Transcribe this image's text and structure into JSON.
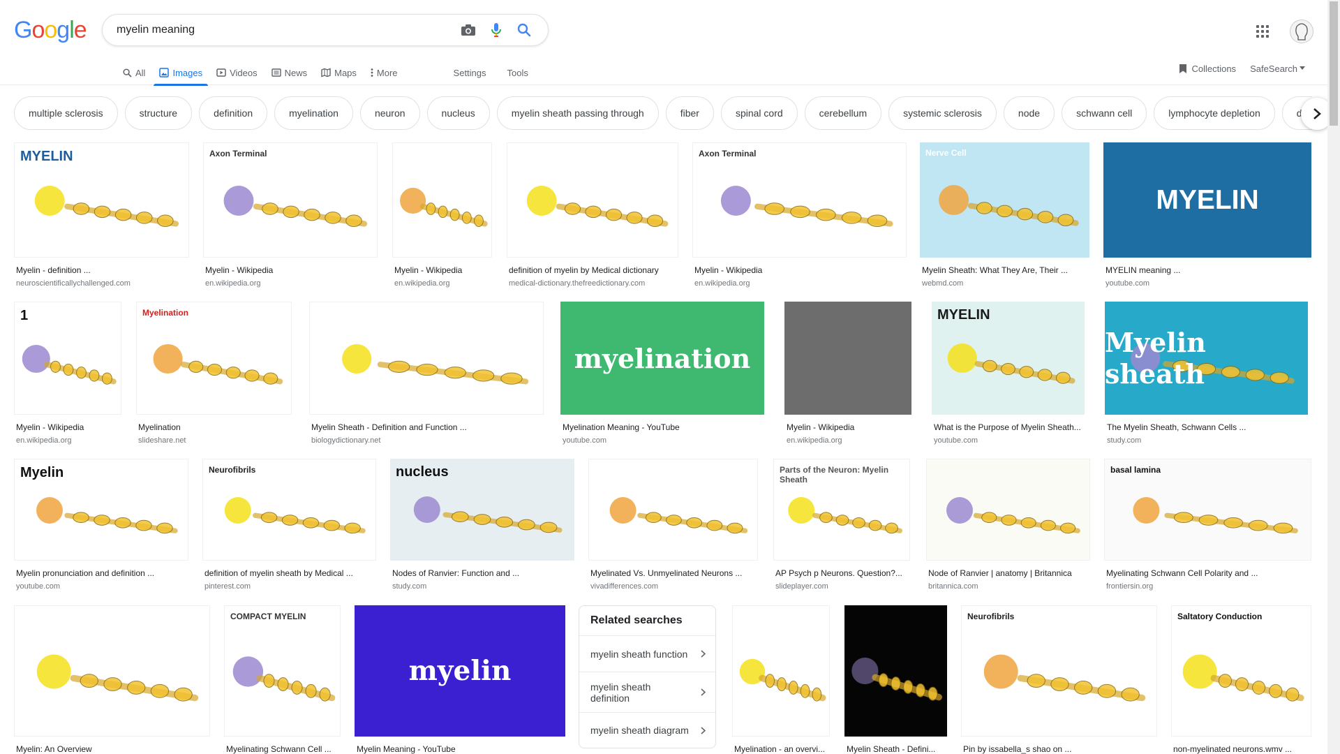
{
  "logo": "Google",
  "search": {
    "value": "myelin meaning",
    "placeholder": ""
  },
  "tabs": [
    {
      "label": "All",
      "icon": "search-icon"
    },
    {
      "label": "Images",
      "icon": "image-icon",
      "active": true
    },
    {
      "label": "Videos",
      "icon": "video-icon"
    },
    {
      "label": "News",
      "icon": "news-icon"
    },
    {
      "label": "Maps",
      "icon": "map-icon"
    },
    {
      "label": "More",
      "icon": "more-vert-icon"
    }
  ],
  "tools": {
    "settings": "Settings",
    "tools": "Tools"
  },
  "right_tabs": {
    "collections": "Collections",
    "safesearch": "SafeSearch"
  },
  "chips": [
    "multiple sclerosis",
    "structure",
    "definition",
    "myelination",
    "neuron",
    "nucleus",
    "myelin sheath passing through",
    "fiber",
    "spinal cord",
    "cerebellum",
    "systemic sclerosis",
    "node",
    "schwann cell",
    "lymphocyte depletion",
    "devel"
  ],
  "results": [
    {
      "title": "Myelin - definition ...",
      "source": "neuroscientificallychallenged.com",
      "thumb_text": "MYELIN",
      "bg": "#ffffff",
      "fg": "#1f5d9a"
    },
    {
      "title": "Myelin - Wikipedia",
      "source": "en.wikipedia.org",
      "thumb_text": "Axon Terminal",
      "bg": "#ffffff",
      "fg": "#333333"
    },
    {
      "title": "Myelin - Wikipedia",
      "source": "en.wikipedia.org",
      "thumb_text": "",
      "bg": "#ffffff",
      "fg": "#333333"
    },
    {
      "title": "definition of myelin by Medical dictionary",
      "source": "medical-dictionary.thefreedictionary.com",
      "thumb_text": "",
      "bg": "#ffffff",
      "fg": "#333333"
    },
    {
      "title": "Myelin - Wikipedia",
      "source": "en.wikipedia.org",
      "thumb_text": "Axon Terminal",
      "bg": "#ffffff",
      "fg": "#333333"
    },
    {
      "title": "Myelin Sheath: What They Are, Their ...",
      "source": "webmd.com",
      "thumb_text": "Nerve Cell",
      "bg": "#bfe6f2",
      "fg": "#ffffff"
    },
    {
      "title": "MYELIN meaning ...",
      "source": "youtube.com",
      "thumb_text": "MYELIN",
      "bg": "#1f6ea3",
      "fg": "#ffffff"
    },
    {
      "title": "Myelin - Wikipedia",
      "source": "en.wikipedia.org",
      "thumb_text": "1",
      "bg": "#ffffff",
      "fg": "#111111"
    },
    {
      "title": "Myelination",
      "source": "slideshare.net",
      "thumb_text": "Myelination",
      "bg": "#ffffff",
      "fg": "#d02020"
    },
    {
      "title": "Myelin Sheath - Definition and Function ...",
      "source": "biologydictionary.net",
      "thumb_text": "",
      "bg": "#ffffff",
      "fg": "#333333"
    },
    {
      "title": "Myelination Meaning - YouTube",
      "source": "youtube.com",
      "thumb_text": "myelination",
      "bg": "#3fb870",
      "fg": "#ffffff"
    },
    {
      "title": "Myelin - Wikipedia",
      "source": "en.wikipedia.org",
      "thumb_text": "",
      "bg": "#6d6d6d",
      "fg": "#ffffff"
    },
    {
      "title": "What is the Purpose of Myelin Sheath...",
      "source": "youtube.com",
      "thumb_text": "MYELIN",
      "bg": "#dff2ef",
      "fg": "#1a1a1a"
    },
    {
      "title": "The Myelin Sheath, Schwann Cells ...",
      "source": "study.com",
      "thumb_text": "Myelin sheath",
      "bg": "#27a9c9",
      "fg": "#ffffff"
    },
    {
      "title": "Myelin pronunciation and definition ...",
      "source": "youtube.com",
      "thumb_text": "Myelin",
      "bg": "#ffffff",
      "fg": "#111111"
    },
    {
      "title": "definition of myelin sheath by Medical ...",
      "source": "pinterest.com",
      "thumb_text": "Neurofibrils",
      "bg": "#ffffff",
      "fg": "#222222"
    },
    {
      "title": "Nodes of Ranvier: Function and ...",
      "source": "study.com",
      "thumb_text": "nucleus",
      "bg": "#e6eef2",
      "fg": "#111111"
    },
    {
      "title": "Myelinated Vs. Unmyelinated Neurons ...",
      "source": "vivadifferences.com",
      "thumb_text": "",
      "bg": "#ffffff",
      "fg": "#333333"
    },
    {
      "title": "AP Psych p Neurons. Question?...",
      "source": "slideplayer.com",
      "thumb_text": "Parts of the Neuron: Myelin Sheath",
      "bg": "#ffffff",
      "fg": "#555555"
    },
    {
      "title": "Node of Ranvier | anatomy | Britannica",
      "source": "britannica.com",
      "thumb_text": "",
      "bg": "#fbfbf6",
      "fg": "#333333"
    },
    {
      "title": "Myelinating Schwann Cell Polarity and ...",
      "source": "frontiersin.org",
      "thumb_text": "basal lamina",
      "bg": "#fafafa",
      "fg": "#111111"
    },
    {
      "title": "Myelin: An Overview",
      "source": "",
      "thumb_text": "",
      "bg": "#ffffff",
      "fg": "#333333"
    },
    {
      "title": "Myelinating Schwann Cell ...",
      "source": "",
      "thumb_text": "COMPACT MYELIN",
      "bg": "#ffffff",
      "fg": "#333333"
    },
    {
      "title": "Myelin Meaning - YouTube",
      "source": "",
      "thumb_text": "myelin",
      "bg": "#3a20d0",
      "fg": "#ffffff"
    },
    {
      "title": "Myelination - an overvi...",
      "source": "",
      "thumb_text": "",
      "bg": "#ffffff",
      "fg": "#333333"
    },
    {
      "title": "Myelin Sheath - Defini...",
      "source": "",
      "thumb_text": "",
      "bg": "#050505",
      "fg": "#ffffff"
    },
    {
      "title": "Pin by issabella_s shao on ...",
      "source": "",
      "thumb_text": "Neurofibrils",
      "bg": "#ffffff",
      "fg": "#222222"
    },
    {
      "title": "non-myelinated neurons.wmv ...",
      "source": "",
      "thumb_text": "Saltatory Conduction",
      "bg": "#ffffff",
      "fg": "#111111"
    }
  ],
  "related": {
    "heading": "Related searches",
    "items": [
      "myelin sheath function",
      "myelin sheath definition",
      "myelin sheath diagram"
    ]
  }
}
